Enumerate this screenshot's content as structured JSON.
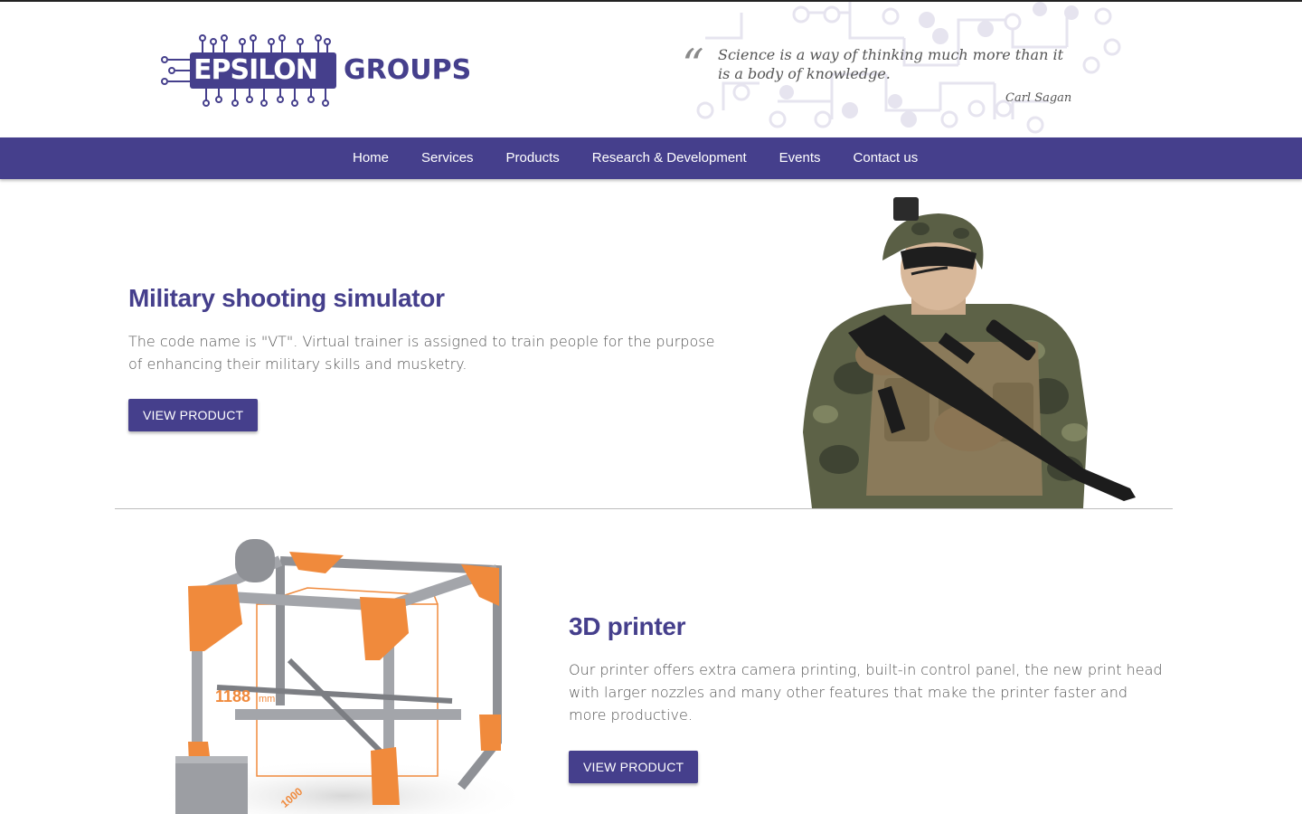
{
  "header": {
    "logo": {
      "word1": "EPSILON",
      "word2": "GROUPS"
    },
    "quote": {
      "mark": "“",
      "text": "Science is a way of thinking much more than it is a body of knowledge.",
      "author": "Carl Sagan"
    }
  },
  "nav": {
    "items": [
      {
        "label": "Home"
      },
      {
        "label": "Services"
      },
      {
        "label": "Products"
      },
      {
        "label": "Research & Development"
      },
      {
        "label": "Events"
      },
      {
        "label": "Contact us"
      }
    ]
  },
  "products": [
    {
      "title": "Military shooting simulator",
      "description": "The code name is \"VT\". Virtual trainer is assigned to train people for the purpose of enhancing their military skills and musketry.",
      "button": "VIEW PRODUCT",
      "image_icon": "soldier-image"
    },
    {
      "title": "3D printer",
      "description": "Our printer offers extra camera printing, built-in control panel, the new print head with larger nozzles and many other features that make the printer faster and more productive.",
      "button": "VIEW PRODUCT",
      "image_icon": "3d-printer-image",
      "image_labels": {
        "dimension": "1188",
        "unit": "mm",
        "base_dimension": "1000"
      }
    }
  ],
  "colors": {
    "brand": "#453f8c",
    "text": "#555555",
    "divider": "#bdbdbd",
    "printer_accent": "#f08a3c"
  }
}
